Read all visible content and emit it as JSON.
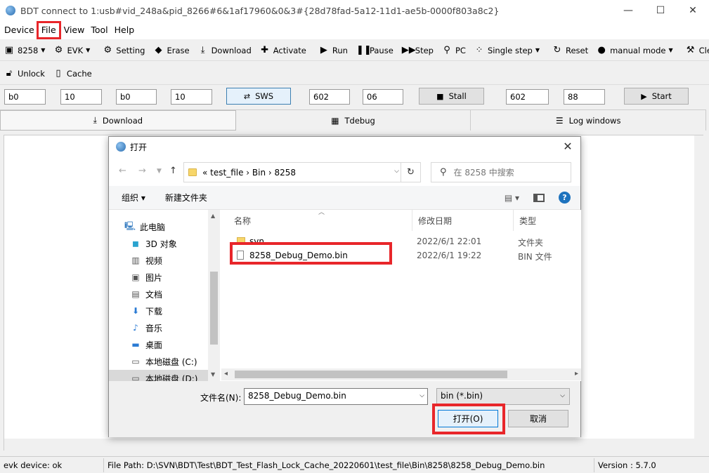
{
  "window": {
    "title": "BDT connect to 1:usb#vid_248a&pid_8266#6&1af17960&0&3#{28d78fad-5a12-11d1-ae5b-0000f803a8c2}",
    "controls": {
      "minimize": "—",
      "maximize": "☐",
      "close": "✕"
    }
  },
  "menubar": [
    "Device",
    "File",
    "View",
    "Tool",
    "Help"
  ],
  "toolbar1": {
    "chip": "8258",
    "board": "EVK",
    "setting": "Setting",
    "erase": "Erase",
    "download": "Download",
    "activate": "Activate",
    "run": "Run",
    "pause": "Pause",
    "step": "Step",
    "pc": "PC",
    "single_step": "Single step",
    "reset": "Reset",
    "manual_mode": "manual mode",
    "clear": "Clear"
  },
  "toolbar2": {
    "unlock": "Unlock",
    "cache": "Cache"
  },
  "row3": {
    "f1": "b0",
    "f2": "10",
    "f3": "b0",
    "f4": "10",
    "sws": "SWS",
    "f5": "602",
    "f6": "06",
    "stall": "Stall",
    "f7": "602",
    "f8": "88",
    "start": "Start"
  },
  "tabs": {
    "download": "Download",
    "tdebug": "Tdebug",
    "log": "Log windows"
  },
  "status": {
    "device": "evk device: ok",
    "filepath": "File Path:  D:\\SVN\\BDT\\Test\\BDT_Test_Flash_Lock_Cache_20220601\\test_file\\Bin\\8258\\8258_Debug_Demo.bin",
    "version": "Version : 5.7.0"
  },
  "dialog": {
    "title": "打开",
    "breadcrumb": "«   test_file   ›   Bin   ›   8258",
    "search_placeholder": "在 8258 中搜索",
    "organize": "组织 ▾",
    "new_folder": "新建文件夹",
    "nav_items": [
      {
        "label": "此电脑",
        "icon": "computer-icon"
      },
      {
        "label": "3D 对象",
        "icon": "cube-icon"
      },
      {
        "label": "视频",
        "icon": "video-icon"
      },
      {
        "label": "图片",
        "icon": "picture-icon"
      },
      {
        "label": "文档",
        "icon": "document-icon"
      },
      {
        "label": "下载",
        "icon": "download-icon"
      },
      {
        "label": "音乐",
        "icon": "music-icon"
      },
      {
        "label": "桌面",
        "icon": "desktop-icon"
      },
      {
        "label": "本地磁盘 (C:)",
        "icon": "drive-icon"
      },
      {
        "label": "本地磁盘 (D:)",
        "icon": "drive-icon"
      }
    ],
    "columns": {
      "name": "名称",
      "date": "修改日期",
      "type": "类型"
    },
    "files": [
      {
        "name": "svn",
        "date": "2022/6/1 22:01",
        "type": "文件夹",
        "icon": "folder-icon"
      },
      {
        "name": "8258_Debug_Demo.bin",
        "date": "2022/6/1 19:22",
        "type": "BIN 文件",
        "icon": "file-icon"
      }
    ],
    "filename_label": "文件名(N):",
    "filename_value": "8258_Debug_Demo.bin",
    "filter": "bin (*.bin)",
    "open_button": "打开(O)",
    "cancel_button": "取消"
  },
  "colors": {
    "highlight": "#e8262a",
    "accent": "#0078d7"
  }
}
